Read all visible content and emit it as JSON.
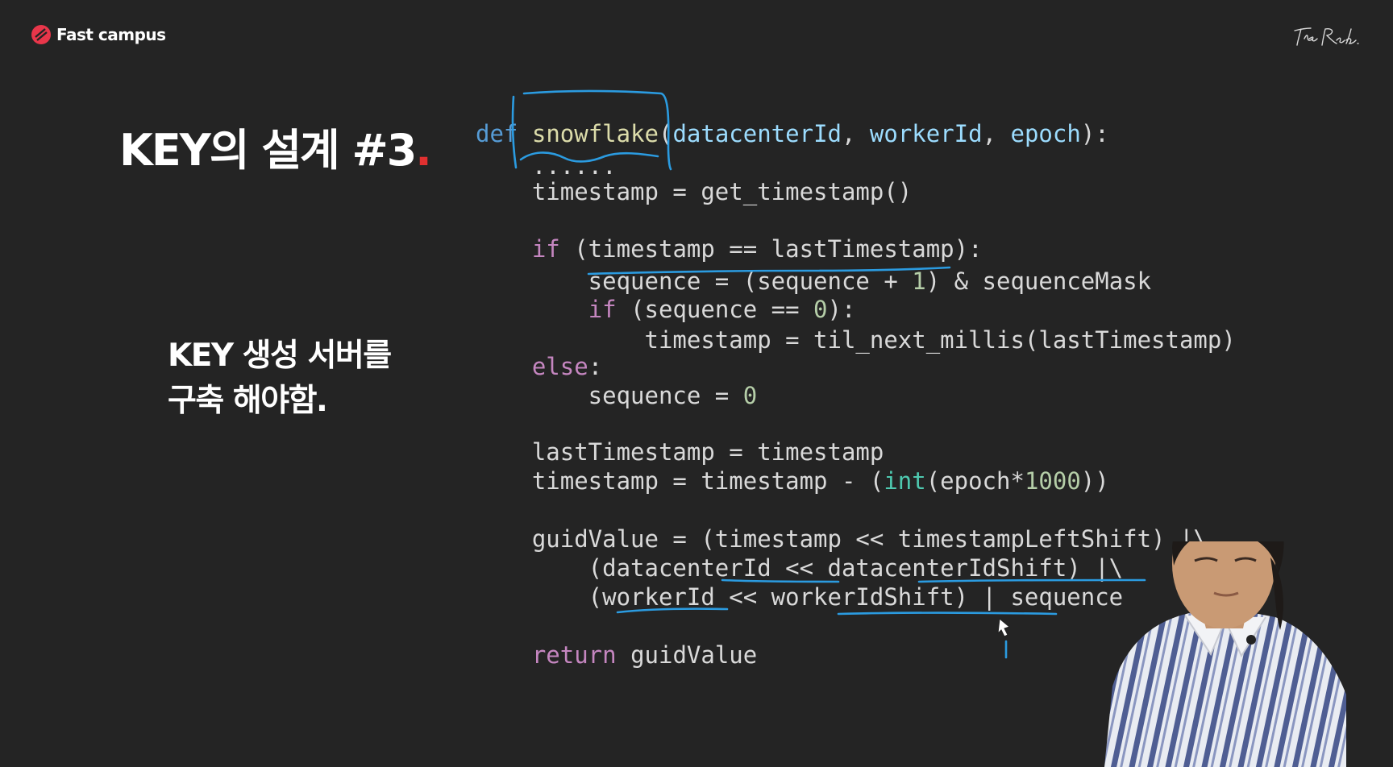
{
  "brand": {
    "name": "Fast campus",
    "color": "#e8364a"
  },
  "signature": {
    "text": "The Red."
  },
  "slide": {
    "title": "KEY의 설계 #3",
    "title_dot": ".",
    "subtitle_line1": "KEY 생성 서버를",
    "subtitle_line2": "구축 해야함."
  },
  "code": {
    "lines": [
      "def snowflake(datacenterId, workerId, epoch):",
      "    ......",
      "    timestamp = get_timestamp()",
      "",
      "    if (timestamp == lastTimestamp):",
      "        sequence = (sequence + 1) & sequenceMask",
      "        if (sequence == 0):",
      "            timestamp = til_next_millis(lastTimestamp)",
      "    else:",
      "        sequence = 0",
      "",
      "    lastTimestamp = timestamp",
      "    timestamp = timestamp - (int(epoch*1000))",
      "",
      "    guidValue = (timestamp << timestampLeftShift) |\\",
      "        (datacenterId << datacenterIdShift) |\\",
      "        (workerId << workerIdShift) | sequence",
      "",
      "    return guidValue"
    ]
  },
  "colors": {
    "background": "#242424",
    "keyword": "#c586c0",
    "def_keyword": "#569cd6",
    "function": "#dcdcaa",
    "parameter": "#9cdcfe",
    "number": "#b5cea8",
    "builtin": "#4ec9b0",
    "annotation_pen": "#2b9be0",
    "title_dot": "#e03030"
  },
  "presenter": {
    "icon": "presenter-video-icon"
  }
}
